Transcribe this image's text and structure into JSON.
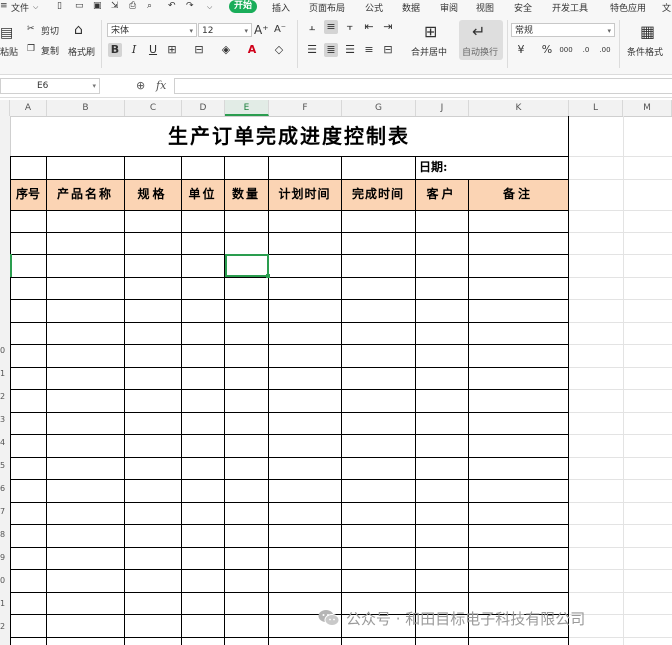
{
  "menubar": {
    "file": "文件",
    "tabs": [
      "开始",
      "插入",
      "页面布局",
      "公式",
      "数据",
      "审阅",
      "视图",
      "安全",
      "开发工具",
      "特色应用"
    ],
    "more": "文"
  },
  "ribbon": {
    "paste": "粘贴",
    "cut": "剪切",
    "copy": "复制",
    "format_painter": "格式刷",
    "font_name": "宋体",
    "font_size": "12",
    "merge_center": "合并居中",
    "wrap_text": "自动换行",
    "number_format": "常规",
    "conditional_format": "条件格式"
  },
  "formula_bar": {
    "name_box": "E6",
    "fx": "fx",
    "value": ""
  },
  "columns": [
    "A",
    "B",
    "C",
    "D",
    "E",
    "F",
    "G",
    "J",
    "K",
    "L",
    "M"
  ],
  "active_column": "E",
  "rows": [
    "",
    "",
    "",
    "",
    "",
    "",
    "",
    "",
    "",
    "0",
    "1",
    "2",
    "3",
    "4",
    "5",
    "6",
    "7",
    "8",
    "9",
    "0",
    "1",
    "2",
    "3"
  ],
  "sheet": {
    "title": "生产订单完成进度控制表",
    "date_label": "日期:",
    "headers": [
      "序号",
      "产品名称",
      "规格",
      "单位",
      "数量",
      "计划时间",
      "完成时间",
      "客户",
      "备注"
    ],
    "header_fill": "#fbd4b4",
    "selected_cell": "E6"
  },
  "watermark": "公众号 · 和田目标电子科技有限公司",
  "colors": {
    "accent": "#1aad5a",
    "selection": "#2a9d4f"
  }
}
